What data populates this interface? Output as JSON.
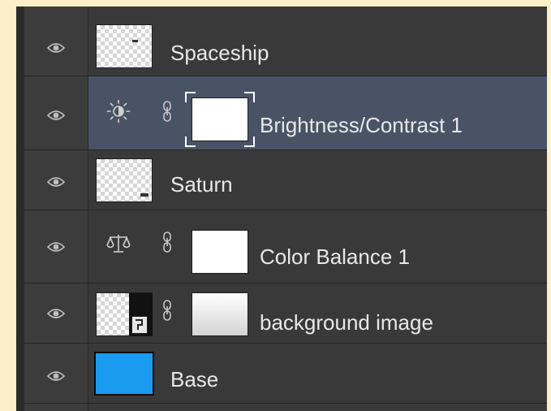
{
  "layers_panel": {
    "layers": [
      {
        "name": "Spaceship",
        "type": "pixel",
        "visible": true,
        "selected": false
      },
      {
        "name": "Brightness/Contrast 1",
        "type": "adjustment",
        "adjustment_icon": "brightness-contrast-icon",
        "visible": true,
        "selected": true
      },
      {
        "name": "Saturn",
        "type": "pixel",
        "visible": true,
        "selected": false
      },
      {
        "name": "Color Balance 1",
        "type": "adjustment",
        "adjustment_icon": "color-balance-icon",
        "visible": true,
        "selected": false
      },
      {
        "name": "background image",
        "type": "smart-object-with-mask",
        "visible": true,
        "selected": false
      },
      {
        "name": "Base",
        "type": "solid-fill",
        "fill_color": "#1a9bf0",
        "visible": true,
        "selected": false
      }
    ],
    "colors": {
      "panel_bg": "#393939",
      "selected_row": "#495366",
      "text": "#e8e8e8",
      "base_fill": "#1a9bf0"
    }
  }
}
